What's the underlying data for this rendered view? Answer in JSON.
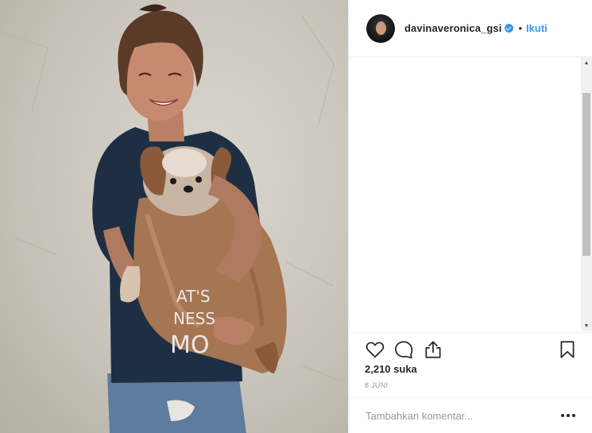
{
  "post": {
    "username": "davinaveronica_gsi",
    "separator": "•",
    "follow_label": "Ikuti",
    "likes_text": "2,210 suka",
    "date_text": "8 JUNI",
    "comment_placeholder": "Tambahkan komentar..."
  },
  "photo": {
    "shirt_text": [
      "AT'S",
      "NESS",
      "MO"
    ]
  },
  "icons": {
    "verified": "verified-badge-icon",
    "like": "heart-icon",
    "comment": "comment-bubble-icon",
    "share": "share-icon",
    "save": "bookmark-icon",
    "more": "more-options-icon"
  },
  "colors": {
    "accent": "#3897f0",
    "text": "#262626",
    "muted": "#999999",
    "border": "#efefef",
    "shirt": "#1e2f44"
  }
}
